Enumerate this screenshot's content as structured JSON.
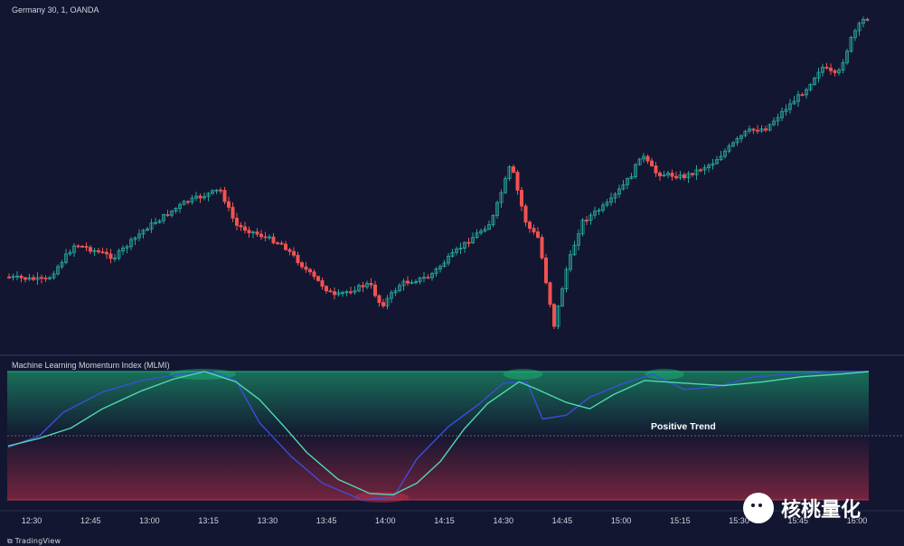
{
  "header": {
    "symbol_title": "Germany 30, 1, OANDA"
  },
  "indicator": {
    "title": "Machine Learning Momentum Index (MLMI)",
    "trend_label": "Positive Trend"
  },
  "branding": {
    "tradingview": "TradingView",
    "watermark": "核桃量化",
    "watermark_icon": "wechat-icon"
  },
  "colors": {
    "background": "#131631",
    "up": "#26a69a",
    "down": "#ef5350",
    "fast_line": "#3a4fd6",
    "slow_line": "#4fd9b0",
    "band_green": "#1db87a",
    "band_red": "#c2304a"
  },
  "chart_data": [
    {
      "type": "candlestick",
      "title": "Germany 30, 1, OANDA",
      "x_ticks": [
        "12:30",
        "12:45",
        "13:00",
        "13:15",
        "13:30",
        "13:45",
        "14:00",
        "14:15",
        "14:30",
        "14:45",
        "15:00",
        "15:15",
        "15:30",
        "15:45",
        "16:00"
      ],
      "price_path": [
        [
          "12:24",
          0.2
        ],
        [
          "12:35",
          0.19
        ],
        [
          "12:42",
          0.3
        ],
        [
          "12:45",
          0.29
        ],
        [
          "12:52",
          0.26
        ],
        [
          "13:00",
          0.35
        ],
        [
          "13:10",
          0.43
        ],
        [
          "13:19",
          0.47
        ],
        [
          "13:23",
          0.36
        ],
        [
          "13:35",
          0.3
        ],
        [
          "13:41",
          0.22
        ],
        [
          "13:48",
          0.14
        ],
        [
          "13:57",
          0.18
        ],
        [
          "14:00",
          0.11
        ],
        [
          "14:05",
          0.18
        ],
        [
          "14:12",
          0.2
        ],
        [
          "14:20",
          0.29
        ],
        [
          "14:28",
          0.37
        ],
        [
          "14:33",
          0.55
        ],
        [
          "14:35",
          0.45
        ],
        [
          "14:37",
          0.36
        ],
        [
          "14:40",
          0.32
        ],
        [
          "14:42",
          0.18
        ],
        [
          "14:44",
          0.05
        ],
        [
          "14:47",
          0.22
        ],
        [
          "14:51",
          0.37
        ],
        [
          "14:58",
          0.43
        ],
        [
          "15:04",
          0.52
        ],
        [
          "15:06",
          0.58
        ],
        [
          "15:10",
          0.52
        ],
        [
          "15:17",
          0.51
        ],
        [
          "15:24",
          0.55
        ],
        [
          "15:33",
          0.65
        ],
        [
          "15:38",
          0.66
        ],
        [
          "15:42",
          0.71
        ],
        [
          "15:48",
          0.78
        ],
        [
          "15:52",
          0.85
        ],
        [
          "15:56",
          0.82
        ],
        [
          "16:00",
          0.95
        ],
        [
          "16:03",
          1.0
        ]
      ]
    },
    {
      "type": "line",
      "title": "Machine Learning Momentum Index (MLMI)",
      "x_ticks": [
        "12:30",
        "12:45",
        "13:00",
        "13:15",
        "13:30",
        "13:45",
        "14:00",
        "14:15",
        "14:30",
        "14:45",
        "15:00",
        "15:15",
        "15:30",
        "15:45",
        "16:00"
      ],
      "ylim": [
        0,
        1
      ],
      "reference_line": 0.5,
      "annotation": "Positive Trend",
      "series": [
        {
          "role": "fast",
          "color": "#3a4fd6",
          "points": [
            [
              "12:24",
              0.41
            ],
            [
              "12:32",
              0.5
            ],
            [
              "12:38",
              0.68
            ],
            [
              "12:48",
              0.84
            ],
            [
              "12:58",
              0.93
            ],
            [
              "13:08",
              0.98
            ],
            [
              "13:16",
              1.0
            ],
            [
              "13:22",
              0.93
            ],
            [
              "13:28",
              0.6
            ],
            [
              "13:36",
              0.34
            ],
            [
              "13:44",
              0.13
            ],
            [
              "13:54",
              0.0
            ],
            [
              "14:02",
              0.02
            ],
            [
              "14:08",
              0.32
            ],
            [
              "14:16",
              0.57
            ],
            [
              "14:24",
              0.75
            ],
            [
              "14:30",
              0.91
            ],
            [
              "14:36",
              0.92
            ],
            [
              "14:40",
              0.63
            ],
            [
              "14:46",
              0.66
            ],
            [
              "14:52",
              0.8
            ],
            [
              "15:00",
              0.9
            ],
            [
              "15:08",
              0.98
            ],
            [
              "15:16",
              0.86
            ],
            [
              "15:24",
              0.88
            ],
            [
              "15:34",
              0.96
            ],
            [
              "15:44",
              0.98
            ],
            [
              "15:54",
              1.0
            ],
            [
              "16:03",
              1.0
            ]
          ]
        },
        {
          "role": "slow",
          "color": "#4fd9b0",
          "points": [
            [
              "12:24",
              0.42
            ],
            [
              "12:32",
              0.48
            ],
            [
              "12:40",
              0.56
            ],
            [
              "12:48",
              0.71
            ],
            [
              "12:58",
              0.85
            ],
            [
              "13:06",
              0.94
            ],
            [
              "13:14",
              1.0
            ],
            [
              "13:22",
              0.92
            ],
            [
              "13:28",
              0.78
            ],
            [
              "13:34",
              0.58
            ],
            [
              "13:40",
              0.37
            ],
            [
              "13:48",
              0.16
            ],
            [
              "13:56",
              0.05
            ],
            [
              "14:02",
              0.04
            ],
            [
              "14:08",
              0.13
            ],
            [
              "14:14",
              0.3
            ],
            [
              "14:20",
              0.55
            ],
            [
              "14:26",
              0.75
            ],
            [
              "14:34",
              0.92
            ],
            [
              "14:38",
              0.87
            ],
            [
              "14:46",
              0.76
            ],
            [
              "14:52",
              0.71
            ],
            [
              "14:58",
              0.82
            ],
            [
              "15:06",
              0.93
            ],
            [
              "15:16",
              0.91
            ],
            [
              "15:26",
              0.89
            ],
            [
              "15:36",
              0.92
            ],
            [
              "15:46",
              0.96
            ],
            [
              "15:56",
              0.98
            ],
            [
              "16:03",
              1.0
            ]
          ]
        }
      ]
    }
  ]
}
